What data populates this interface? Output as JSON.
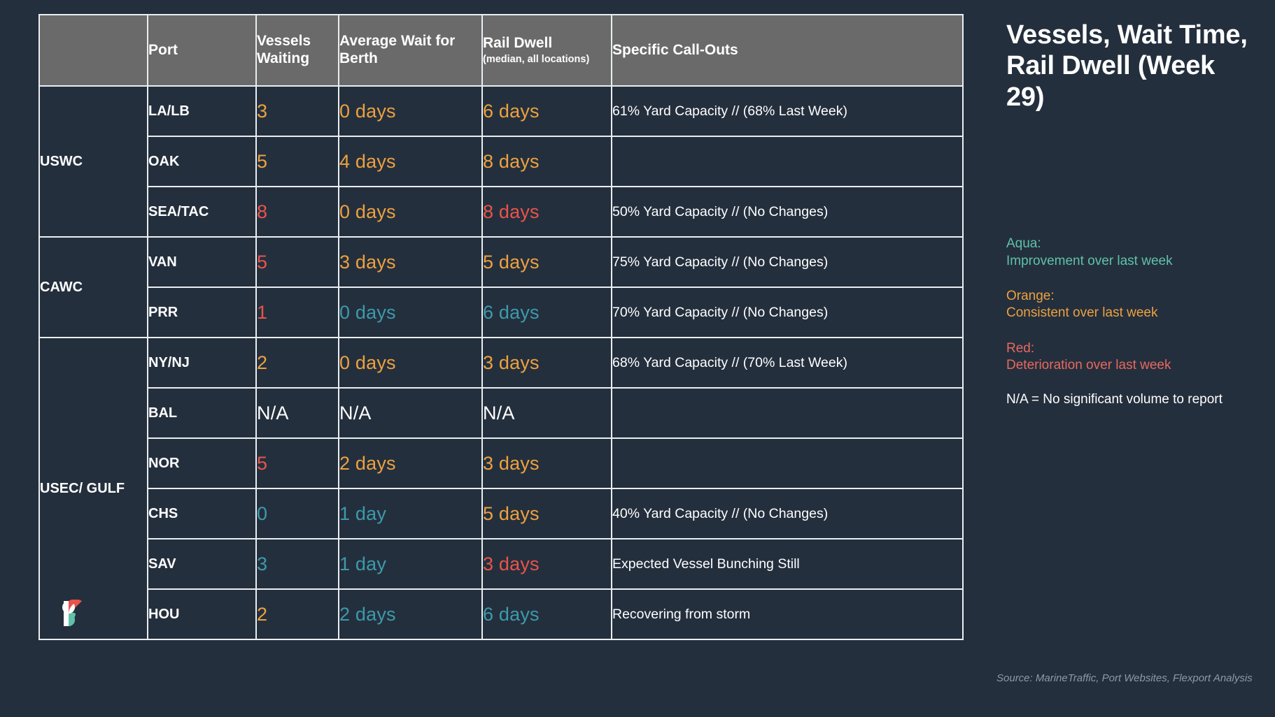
{
  "table": {
    "headers": {
      "corner": "",
      "port": "Port",
      "vessels_waiting": "Vessels Waiting",
      "average_wait": "Average Wait for Berth",
      "rail_dwell": "Rail Dwell",
      "rail_dwell_note": "(median, all locations)",
      "callouts": "Specific Call-Outs"
    },
    "regions": [
      {
        "label": "USWC",
        "rowspan": 3
      },
      {
        "label": "CAWC",
        "rowspan": 2
      },
      {
        "label": "USEC/ GULF",
        "rowspan": 6
      }
    ],
    "rows": [
      {
        "port": "LA/LB",
        "vessels": {
          "value": "3",
          "color": "orange"
        },
        "wait": {
          "value": "0 days",
          "color": "orange"
        },
        "dwell": {
          "value": "6 days",
          "color": "orange"
        },
        "callout": "61% Yard Capacity // (68% Last Week)"
      },
      {
        "port": "OAK",
        "vessels": {
          "value": "5",
          "color": "orange"
        },
        "wait": {
          "value": "4 days",
          "color": "orange"
        },
        "dwell": {
          "value": "8 days",
          "color": "orange"
        },
        "callout": ""
      },
      {
        "port": "SEA/TAC",
        "vessels": {
          "value": "8",
          "color": "red"
        },
        "wait": {
          "value": "0 days",
          "color": "orange"
        },
        "dwell": {
          "value": "8 days",
          "color": "red"
        },
        "callout": "50% Yard Capacity // (No Changes)"
      },
      {
        "port": "VAN",
        "vessels": {
          "value": "5",
          "color": "red"
        },
        "wait": {
          "value": "3 days",
          "color": "orange"
        },
        "dwell": {
          "value": "5 days",
          "color": "orange"
        },
        "callout": "75% Yard Capacity // (No Changes)"
      },
      {
        "port": "PRR",
        "vessels": {
          "value": "1",
          "color": "red"
        },
        "wait": {
          "value": "0 days",
          "color": "aqua"
        },
        "dwell": {
          "value": "6 days",
          "color": "aqua"
        },
        "callout": "70% Yard Capacity // (No Changes)"
      },
      {
        "port": "NY/NJ",
        "vessels": {
          "value": "2",
          "color": "orange"
        },
        "wait": {
          "value": "0 days",
          "color": "orange"
        },
        "dwell": {
          "value": "3 days",
          "color": "orange"
        },
        "callout": "68% Yard Capacity // (70% Last Week)"
      },
      {
        "port": "BAL",
        "vessels": {
          "value": "N/A",
          "color": "white"
        },
        "wait": {
          "value": "N/A",
          "color": "white"
        },
        "dwell": {
          "value": "N/A",
          "color": "white"
        },
        "callout": ""
      },
      {
        "port": "NOR",
        "vessels": {
          "value": "5",
          "color": "red"
        },
        "wait": {
          "value": "2 days",
          "color": "orange"
        },
        "dwell": {
          "value": "3 days",
          "color": "orange"
        },
        "callout": ""
      },
      {
        "port": "CHS",
        "vessels": {
          "value": "0",
          "color": "aqua"
        },
        "wait": {
          "value": "1 day",
          "color": "aqua"
        },
        "dwell": {
          "value": "5 days",
          "color": "orange"
        },
        "callout": "40% Yard Capacity // (No Changes)"
      },
      {
        "port": "SAV",
        "vessels": {
          "value": "3",
          "color": "aqua"
        },
        "wait": {
          "value": "1 day",
          "color": "aqua"
        },
        "dwell": {
          "value": "3 days",
          "color": "red"
        },
        "callout": "Expected Vessel Bunching Still"
      },
      {
        "port": "HOU",
        "vessels": {
          "value": "2",
          "color": "orange"
        },
        "wait": {
          "value": "2 days",
          "color": "aqua"
        },
        "dwell": {
          "value": "6 days",
          "color": "aqua"
        },
        "callout": "Recovering from storm"
      }
    ]
  },
  "side": {
    "title": "Vessels, Wait Time, Rail Dwell (Week 29)",
    "legend": [
      {
        "term": "Aqua:",
        "desc": "Improvement over last week",
        "color": "#5fc2a8"
      },
      {
        "term": "Orange:",
        "desc": "Consistent over last week",
        "color": "#eda13f"
      },
      {
        "term": "Red:",
        "desc": "Deterioration over last week",
        "color": "#e8685f"
      }
    ],
    "na_note": "N/A = No significant volume to report",
    "source": "Source: MarineTraffic, Port Websites, Flexport Analysis"
  },
  "colors": {
    "background": "#242f3d",
    "header_bg": "#6a6a6a",
    "border": "#e9eef2",
    "orange": "#eda13f",
    "red": "#e8544a",
    "aqua": "#3d9aab",
    "white": "#ffffff"
  }
}
